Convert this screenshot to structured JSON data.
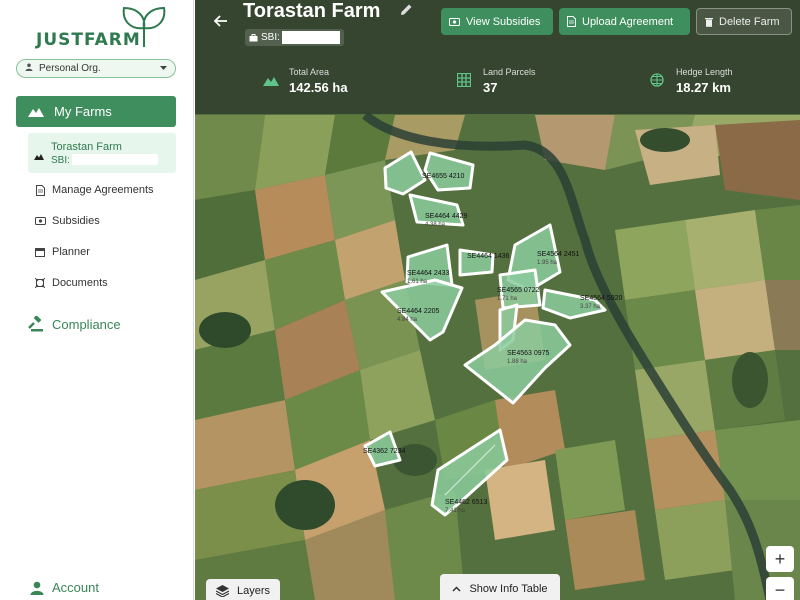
{
  "app": {
    "logo_text": "JUSTFARM"
  },
  "sidebar": {
    "org_selector": {
      "label": "Personal Org."
    },
    "my_farms": {
      "label": "My Farms"
    },
    "selected_farm": {
      "name": "Torastan Farm",
      "sbi_label": "SBI:"
    },
    "items": [
      {
        "label": "Manage Agreements",
        "icon": "document-icon"
      },
      {
        "label": "Subsidies",
        "icon": "money-icon"
      },
      {
        "label": "Planner",
        "icon": "calendar-icon"
      },
      {
        "label": "Documents",
        "icon": "documents-icon"
      }
    ],
    "compliance": {
      "label": "Compliance"
    },
    "account": {
      "label": "Account"
    }
  },
  "header": {
    "title": "Torastan Farm",
    "sbi_label": "SBI:",
    "buttons": {
      "view_subsidies": "View Subsidies",
      "upload_agreement": "Upload Agreement",
      "delete_farm": "Delete Farm"
    },
    "stats": [
      {
        "label": "Total Area",
        "value": "142.56 ha",
        "icon": "mountain-icon"
      },
      {
        "label": "Land Parcels",
        "value": "37",
        "icon": "grid-icon"
      },
      {
        "label": "Hedge Length",
        "value": "18.27 km",
        "icon": "hedge-icon"
      }
    ]
  },
  "map": {
    "parcels": [
      {
        "id": "SE4655 4210",
        "area": ""
      },
      {
        "id": "SE4464 4429",
        "area": "4.38 ha"
      },
      {
        "id": "SE4464 2433",
        "area": "1.61 ha"
      },
      {
        "id": "SE4464 1436",
        "area": ""
      },
      {
        "id": "SE4564 2451",
        "area": "1.95 ha"
      },
      {
        "id": "SE4565 0722",
        "area": "1.71 ha"
      },
      {
        "id": "SE4564 5920",
        "area": "3.37 ha"
      },
      {
        "id": "SE4464 2205",
        "area": "4.84 ha"
      },
      {
        "id": "SE4563 0975",
        "area": "1.88 ha"
      },
      {
        "id": "SE4362 7234",
        "area": ""
      },
      {
        "id": "SE4462 6513",
        "area": "7.41 ha"
      }
    ],
    "controls": {
      "zoom_in": "+",
      "zoom_out": "−",
      "layers": "Layers",
      "info_table": "Show Info Table"
    }
  },
  "colors": {
    "brand_green": "#3f8f5e",
    "sidebar_selected_bg": "#e7f6ec",
    "parcel_fill": "#8ccb9e"
  }
}
